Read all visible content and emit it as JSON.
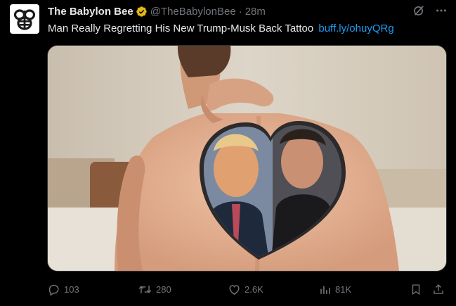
{
  "tweet": {
    "author_name": "The Babylon Bee",
    "author_handle": "@TheBabylonBee",
    "separator": "·",
    "timestamp": "28m",
    "verified": true,
    "text": "Man Really Regretting His New Trump-Musk Back Tattoo",
    "link_text": "buff.ly/ohuyQRg"
  },
  "media": {
    "kind": "photo",
    "subject": "shirtless man's back with heart-shaped portrait tattoo"
  },
  "actions": {
    "replies": "103",
    "reposts": "280",
    "likes": "2.6K",
    "views": "81K"
  },
  "colors": {
    "background": "#000000",
    "text": "#e7e9ea",
    "muted": "#71767b",
    "link": "#1d9bf0",
    "verified_badge": "#e2b719",
    "avatar_logo": "#1a1a1a"
  }
}
